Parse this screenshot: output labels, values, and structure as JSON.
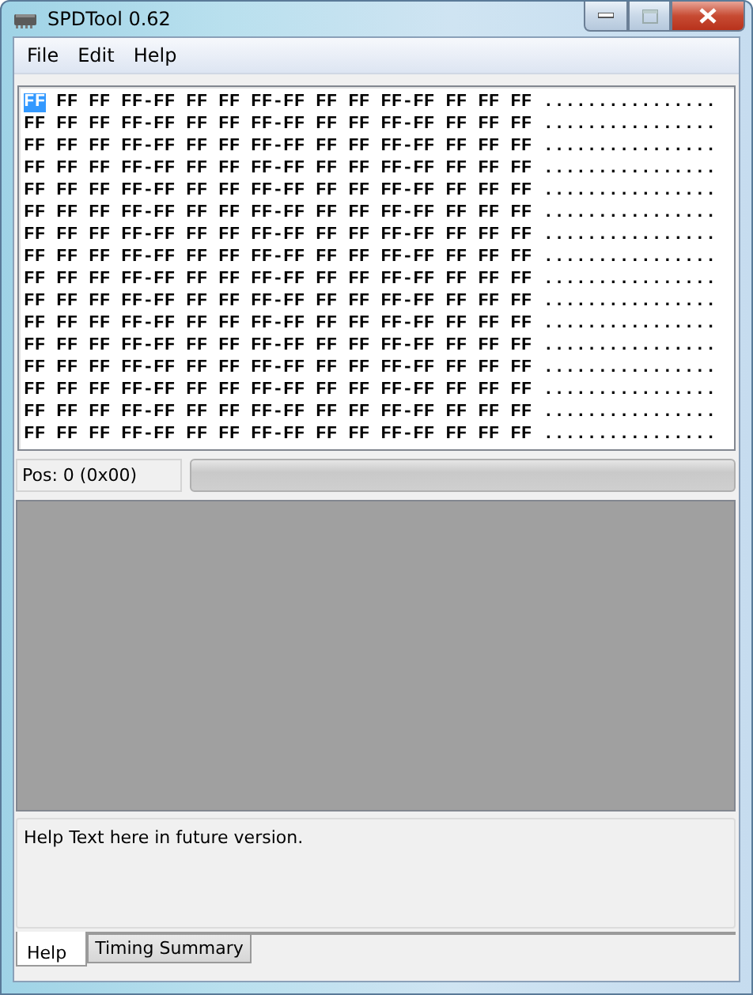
{
  "window": {
    "title": "SPDTool 0.62"
  },
  "menu": [
    {
      "label": "File"
    },
    {
      "label": "Edit"
    },
    {
      "label": "Help"
    }
  ],
  "hex": {
    "rows": [
      {
        "segments": [
          {
            "text": "FF",
            "selected": true
          },
          {
            "text": " FF FF FF-FF FF FF FF-FF FF FF FF-FF FF FF FF",
            "selected": false
          }
        ],
        "ascii": "................"
      },
      {
        "segments": [
          {
            "text": "FF FF FF FF-FF FF FF FF-FF FF FF FF-FF FF FF FF",
            "selected": false
          }
        ],
        "ascii": "................"
      },
      {
        "segments": [
          {
            "text": "FF FF FF FF-FF FF FF FF-FF FF FF FF-FF FF FF FF",
            "selected": false
          }
        ],
        "ascii": "................"
      },
      {
        "segments": [
          {
            "text": "FF FF FF FF-FF FF FF FF-FF FF FF FF-FF FF FF FF",
            "selected": false
          }
        ],
        "ascii": "................"
      },
      {
        "segments": [
          {
            "text": "FF FF FF FF-FF FF FF FF-FF FF FF FF-FF FF FF FF",
            "selected": false
          }
        ],
        "ascii": "................"
      },
      {
        "segments": [
          {
            "text": "FF FF FF FF-FF FF FF FF-FF FF FF FF-FF FF FF FF",
            "selected": false
          }
        ],
        "ascii": "................"
      },
      {
        "segments": [
          {
            "text": "FF FF FF FF-FF FF FF FF-FF FF FF FF-FF FF FF FF",
            "selected": false
          }
        ],
        "ascii": "................"
      },
      {
        "segments": [
          {
            "text": "FF FF FF FF-FF FF FF FF-FF FF FF FF-FF FF FF FF",
            "selected": false
          }
        ],
        "ascii": "................"
      },
      {
        "segments": [
          {
            "text": "FF FF FF FF-FF FF FF FF-FF FF FF FF-FF FF FF FF",
            "selected": false
          }
        ],
        "ascii": "................"
      },
      {
        "segments": [
          {
            "text": "FF FF FF FF-FF FF FF FF-FF FF FF FF-FF FF FF FF",
            "selected": false
          }
        ],
        "ascii": "................"
      },
      {
        "segments": [
          {
            "text": "FF FF FF FF-FF FF FF FF-FF FF FF FF-FF FF FF FF",
            "selected": false
          }
        ],
        "ascii": "................"
      },
      {
        "segments": [
          {
            "text": "FF FF FF FF-FF FF FF FF-FF FF FF FF-FF FF FF FF",
            "selected": false
          }
        ],
        "ascii": "................"
      },
      {
        "segments": [
          {
            "text": "FF FF FF FF-FF FF FF FF-FF FF FF FF-FF FF FF FF",
            "selected": false
          }
        ],
        "ascii": "................"
      },
      {
        "segments": [
          {
            "text": "FF FF FF FF-FF FF FF FF-FF FF FF FF-FF FF FF FF",
            "selected": false
          }
        ],
        "ascii": "................"
      },
      {
        "segments": [
          {
            "text": "FF FF FF FF-FF FF FF FF-FF FF FF FF-FF FF FF FF",
            "selected": false
          }
        ],
        "ascii": "................"
      },
      {
        "segments": [
          {
            "text": "FF FF FF FF-FF FF FF FF-FF FF FF FF-FF FF FF FF",
            "selected": false
          }
        ],
        "ascii": "................"
      }
    ]
  },
  "status": {
    "position": "Pos: 0 (0x00)"
  },
  "help_text": "Help Text here in future version.",
  "tabs": [
    {
      "label": "Help",
      "selected": true
    },
    {
      "label": "Timing Summary",
      "selected": false
    }
  ]
}
